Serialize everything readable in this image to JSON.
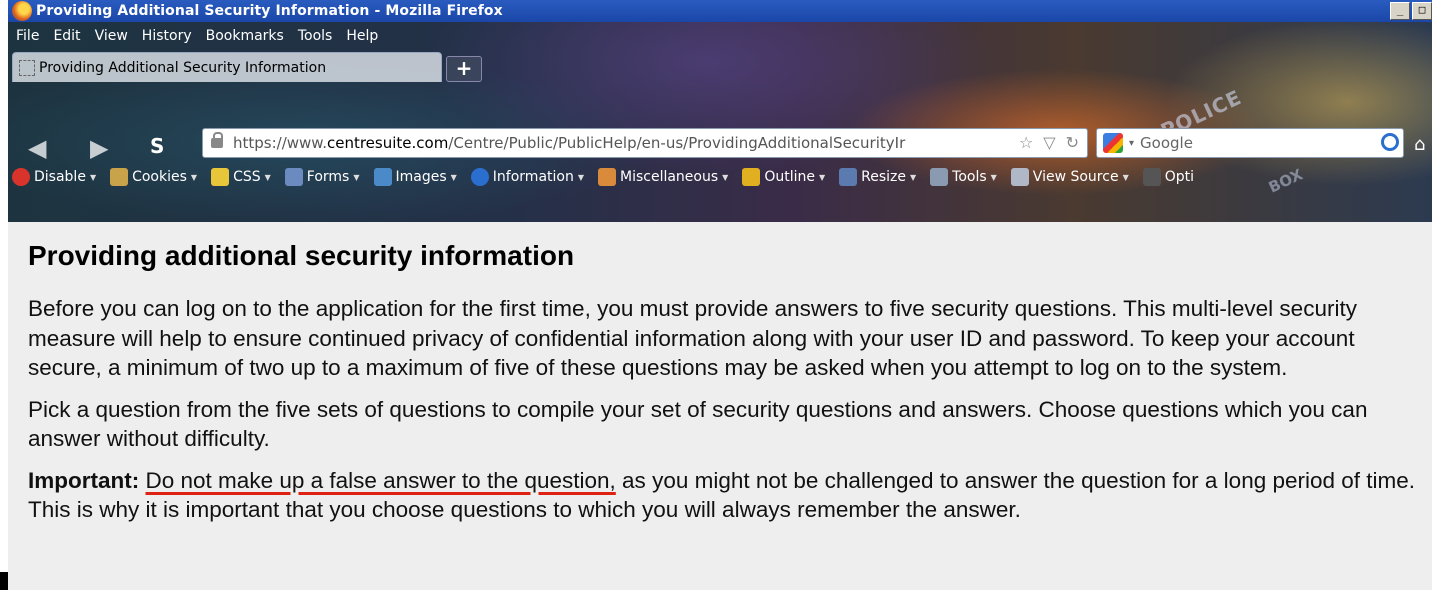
{
  "window": {
    "title": "Providing Additional Security Information - Mozilla Firefox",
    "min_symbol": "_",
    "max_symbol": "□"
  },
  "menu": [
    "File",
    "Edit",
    "View",
    "History",
    "Bookmarks",
    "Tools",
    "Help"
  ],
  "tab": {
    "label": "Providing Additional Security Information",
    "new_tab": "+"
  },
  "nav": {
    "s_label": "S",
    "url_prefix": "https://www.",
    "url_host": "centresuite.com",
    "url_path": "/Centre/Public/PublicHelp/en-us/ProvidingAdditionalSecurityIr",
    "search_placeholder": "Google"
  },
  "devbar": [
    {
      "label": "Disable",
      "color": "#d9342b"
    },
    {
      "label": "Cookies",
      "color": "#c9a34a"
    },
    {
      "label": "CSS",
      "color": "#e8c63a"
    },
    {
      "label": "Forms",
      "color": "#6a8ac0"
    },
    {
      "label": "Images",
      "color": "#4a8ac8"
    },
    {
      "label": "Information",
      "color": "#2a6fd0"
    },
    {
      "label": "Miscellaneous",
      "color": "#d98a3a"
    },
    {
      "label": "Outline",
      "color": "#e0b020"
    },
    {
      "label": "Resize",
      "color": "#5a7ab0"
    },
    {
      "label": "Tools",
      "color": "#8a9ab0"
    },
    {
      "label": "View Source",
      "color": "#b0b8c8"
    },
    {
      "label": "Opti",
      "color": "#555555"
    }
  ],
  "page": {
    "heading": "Providing additional security information",
    "para1": "Before you can log on to the application for the first time, you must provide answers to five security questions. This multi-level security measure will help to ensure continued privacy of confidential information along with your user ID and password. To keep your account secure, a minimum of two up to a maximum of five of these questions may be asked when you attempt to log on to the system.",
    "para2": "Pick a question from the five sets of questions to compile your set of security questions and answers. Choose questions which you can answer without difficulty.",
    "important_label": "Important:",
    "important_underlined": "Do not make up a false answer to the question,",
    "important_rest": " as you might not be challenged to answer the question for a long period of time. This is why it is important that you choose questions to which you will always remember the answer."
  }
}
